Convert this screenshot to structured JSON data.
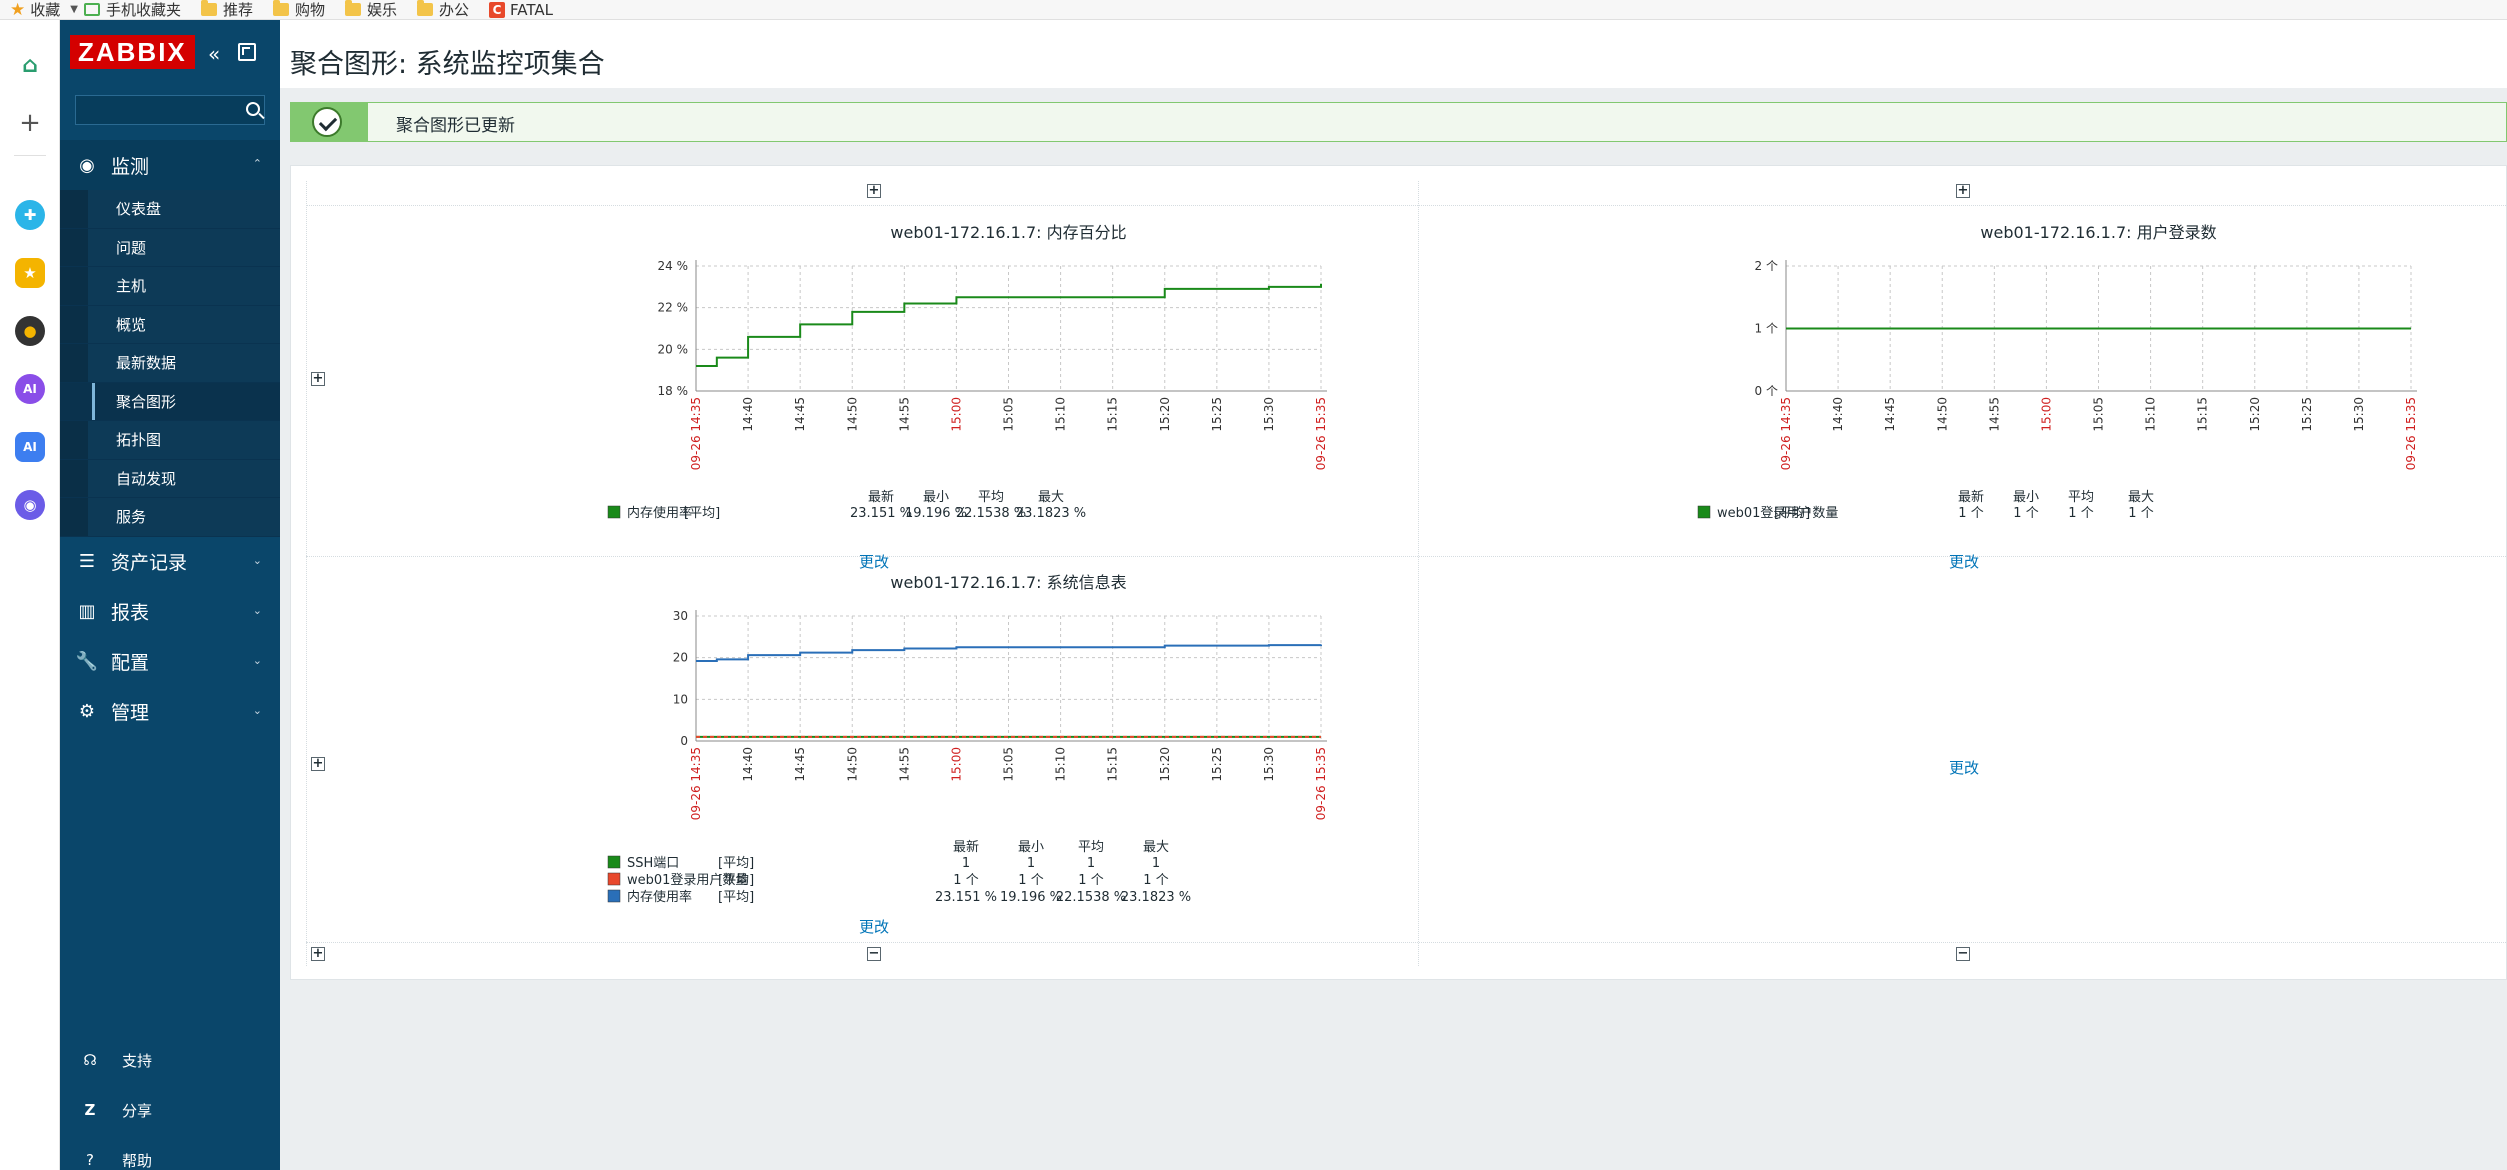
{
  "browser": {
    "bookmarks": [
      {
        "label": "收藏",
        "icon": "star-icon"
      },
      {
        "label": "手机收藏夹",
        "icon": "phone-icon"
      },
      {
        "label": "推荐",
        "icon": "folder-icon"
      },
      {
        "label": "购物",
        "icon": "folder-icon"
      },
      {
        "label": "娱乐",
        "icon": "folder-icon"
      },
      {
        "label": "办公",
        "icon": "folder-icon"
      },
      {
        "label": "FATAL",
        "icon": "fatal-icon"
      }
    ]
  },
  "sidebar": {
    "logo": "ZABBIX",
    "search_placeholder": "",
    "monitoring": {
      "label": "监测",
      "items": [
        "仪表盘",
        "问题",
        "主机",
        "概览",
        "最新数据",
        "聚合图形",
        "拓扑图",
        "自动发现",
        "服务"
      ],
      "active_index": 5
    },
    "sections": [
      "资产记录",
      "报表",
      "配置",
      "管理"
    ],
    "bottom": [
      "支持",
      "分享",
      "帮助"
    ]
  },
  "header": {
    "title": "聚合图形: 系统监控项集合"
  },
  "message": {
    "text": "聚合图形已更新",
    "color": "#82c870"
  },
  "screen": {
    "change_label": "更改",
    "x_labels": [
      "09-26 14:35",
      "14:40",
      "14:45",
      "14:50",
      "14:55",
      "15:00",
      "15:05",
      "15:10",
      "15:15",
      "15:20",
      "15:25",
      "15:30",
      "09-26 15:35"
    ],
    "red_labels": [
      "09-26 14:35",
      "15:00",
      "09-26 15:35"
    ]
  },
  "chart_data": [
    {
      "type": "line",
      "title": "web01-172.16.1.7: 内存百分比",
      "y_ticks": [
        "18 %",
        "20 %",
        "22 %",
        "24 %"
      ],
      "ylim": [
        18,
        24
      ],
      "x": [
        "14:35",
        "14:37",
        "14:40",
        "14:45",
        "14:50",
        "14:55",
        "15:00",
        "15:05",
        "15:10",
        "15:15",
        "15:20",
        "15:25",
        "15:30",
        "15:35"
      ],
      "series": [
        {
          "name": "内存使用率",
          "color": "#1a8a1a",
          "values": [
            19.2,
            19.6,
            20.6,
            21.2,
            21.8,
            22.2,
            22.5,
            22.5,
            22.5,
            22.5,
            22.9,
            22.9,
            23.0,
            23.15
          ]
        }
      ],
      "legend_header": [
        "最新",
        "最小",
        "平均",
        "最大"
      ],
      "legend_rows": [
        {
          "name": "内存使用率",
          "func": "[平均]",
          "last": "23.151 %",
          "min": "19.196 %",
          "avg": "22.1538 %",
          "max": "23.1823 %",
          "color": "#1a8a1a"
        }
      ]
    },
    {
      "type": "line",
      "title": "web01-172.16.1.7: 用户登录数",
      "y_ticks": [
        "0 个",
        "1 个",
        "2 个"
      ],
      "ylim": [
        0,
        2
      ],
      "x": [
        "14:35",
        "15:35"
      ],
      "series": [
        {
          "name": "web01登录用户数量",
          "color": "#1a8a1a",
          "values": [
            1,
            1
          ]
        }
      ],
      "legend_header": [
        "最新",
        "最小",
        "平均",
        "最大"
      ],
      "legend_rows": [
        {
          "name": "web01登录用户数量",
          "func": "[平均]",
          "last": "1 个",
          "min": "1 个",
          "avg": "1 个",
          "max": "1 个",
          "color": "#1a8a1a"
        }
      ]
    },
    {
      "type": "line",
      "title": "web01-172.16.1.7: 系统信息表",
      "y_ticks": [
        "0",
        "10",
        "20",
        "30"
      ],
      "ylim": [
        0,
        30
      ],
      "x": [
        "14:35",
        "14:37",
        "14:40",
        "14:45",
        "14:50",
        "14:55",
        "15:00",
        "15:05",
        "15:10",
        "15:15",
        "15:20",
        "15:25",
        "15:30",
        "15:35"
      ],
      "series": [
        {
          "name": "SSH端口",
          "color": "#1a8a1a",
          "values": [
            1,
            1,
            1,
            1,
            1,
            1,
            1,
            1,
            1,
            1,
            1,
            1,
            1,
            1
          ]
        },
        {
          "name": "web01登录用户数量",
          "color": "#e8482c",
          "values": [
            1,
            1,
            1,
            1,
            1,
            1,
            1,
            1,
            1,
            1,
            1,
            1,
            1,
            1
          ]
        },
        {
          "name": "内存使用率",
          "color": "#2a6fb8",
          "values": [
            19.2,
            19.6,
            20.6,
            21.2,
            21.8,
            22.2,
            22.5,
            22.5,
            22.5,
            22.5,
            22.9,
            22.9,
            23.0,
            23.15
          ]
        }
      ],
      "legend_header": [
        "最新",
        "最小",
        "平均",
        "最大"
      ],
      "legend_rows": [
        {
          "name": "SSH端口",
          "func": "[平均]",
          "last": "1",
          "min": "1",
          "avg": "1",
          "max": "1",
          "color": "#1a8a1a"
        },
        {
          "name": "web01登录用户数量",
          "func": "[平均]",
          "last": "1 个",
          "min": "1 个",
          "avg": "1 个",
          "max": "1 个",
          "color": "#e8482c"
        },
        {
          "name": "内存使用率",
          "func": "[平均]",
          "last": "23.151 %",
          "min": "19.196 %",
          "avg": "22.1538 %",
          "max": "23.1823 %",
          "color": "#2a6fb8"
        }
      ]
    }
  ]
}
